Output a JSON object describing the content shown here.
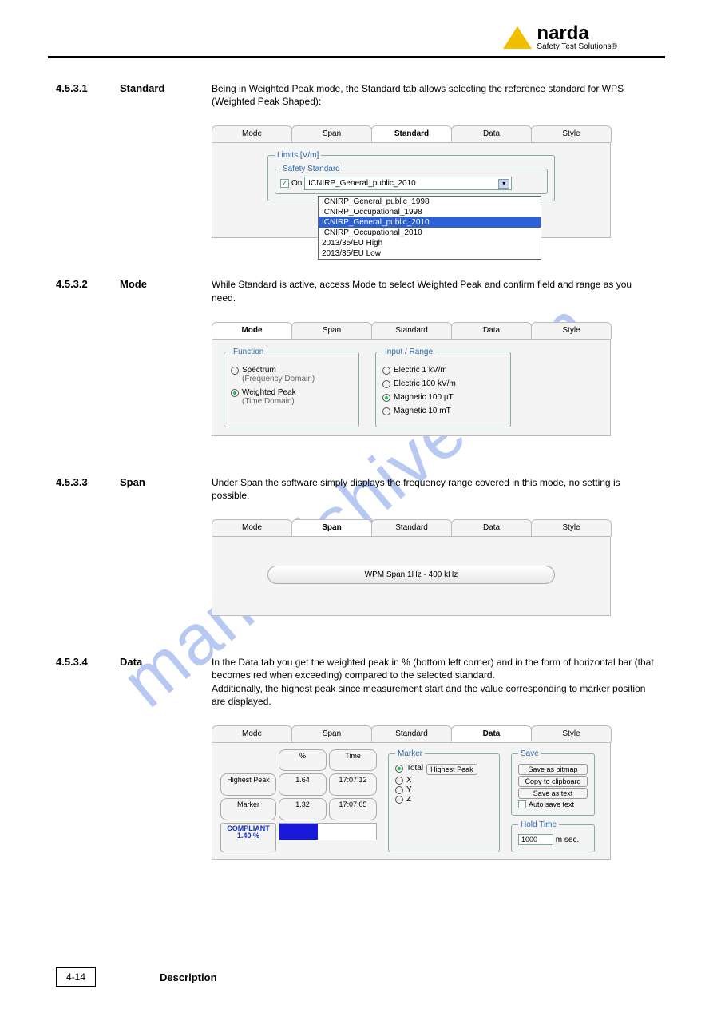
{
  "header": {
    "brand": "narda",
    "tagline": "Safety Test Solutions®"
  },
  "watermark": "manualshive.com",
  "sections": {
    "standard": {
      "num": "4.5.3.1",
      "title": "Standard",
      "desc": "Being in Weighted Peak mode, the Standard tab allows selecting the reference standard for WPS (Weighted Peak Shaped):"
    },
    "mode": {
      "num": "4.5.3.2",
      "title": "Mode",
      "desc": "While Standard is active, access Mode to select Weighted Peak and confirm field and range as you need."
    },
    "span": {
      "num": "4.5.3.3",
      "title": "Span",
      "desc": "Under Span the software simply displays the frequency range covered in this mode, no setting is possible."
    },
    "data": {
      "num": "4.5.3.4",
      "title": "Data",
      "desc": "In the Data tab you get the weighted peak in % (bottom left corner) and in the form of horizontal bar (that becomes red when exceeding) compared to the selected standard.\nAdditionally, the highest peak since measurement start and the value corresponding to marker position are displayed."
    }
  },
  "tabs": [
    "Mode",
    "Span",
    "Standard",
    "Data",
    "Style"
  ],
  "standardPanel": {
    "limitsLabel": "Limits [V/m]",
    "safetyLabel": "Safety Standard",
    "onLabel": "On",
    "selected": "ICNIRP_General_public_2010",
    "options": [
      "ICNIRP_General_public_1998",
      "ICNIRP_Occupational_1998",
      "ICNIRP_General_public_2010",
      "ICNIRP_Occupational_2010",
      "2013/35/EU High",
      "2013/35/EU Low"
    ]
  },
  "modePanel": {
    "functionLabel": "Function",
    "func1": "Spectrum",
    "func1sub": "(Frequency Domain)",
    "func2": "Weighted Peak",
    "func2sub": "(Time Domain)",
    "inputLabel": "Input / Range",
    "ranges": [
      "Electric 1 kV/m",
      "Electric 100 kV/m",
      "Magnetic 100 µT",
      "Magnetic 10 mT"
    ]
  },
  "spanPanel": {
    "text": "WPM Span 1Hz - 400 kHz"
  },
  "dataPanel": {
    "colPct": "%",
    "colTime": "Time",
    "rowHP": "Highest Peak",
    "rowMk": "Marker",
    "hpPct": "1.64",
    "hpTime": "17:07:12",
    "mkPct": "1.32",
    "mkTime": "17:07:05",
    "compliant": "COMPLIANT",
    "compliantVal": "1.40 %",
    "markerLabel": "Marker",
    "markerTotal": "Total",
    "markerX": "X",
    "markerY": "Y",
    "markerZ": "Z",
    "hpBtn": "Highest Peak",
    "saveLabel": "Save",
    "saveBitmap": "Save as bitmap",
    "copyClip": "Copy to clipboard",
    "saveText": "Save as text",
    "autoSave": "Auto save text",
    "holdLabel": "Hold Time",
    "holdVal": "1000",
    "holdUnit": "m sec."
  },
  "footer": {
    "page": "4-14",
    "title": "Description"
  }
}
